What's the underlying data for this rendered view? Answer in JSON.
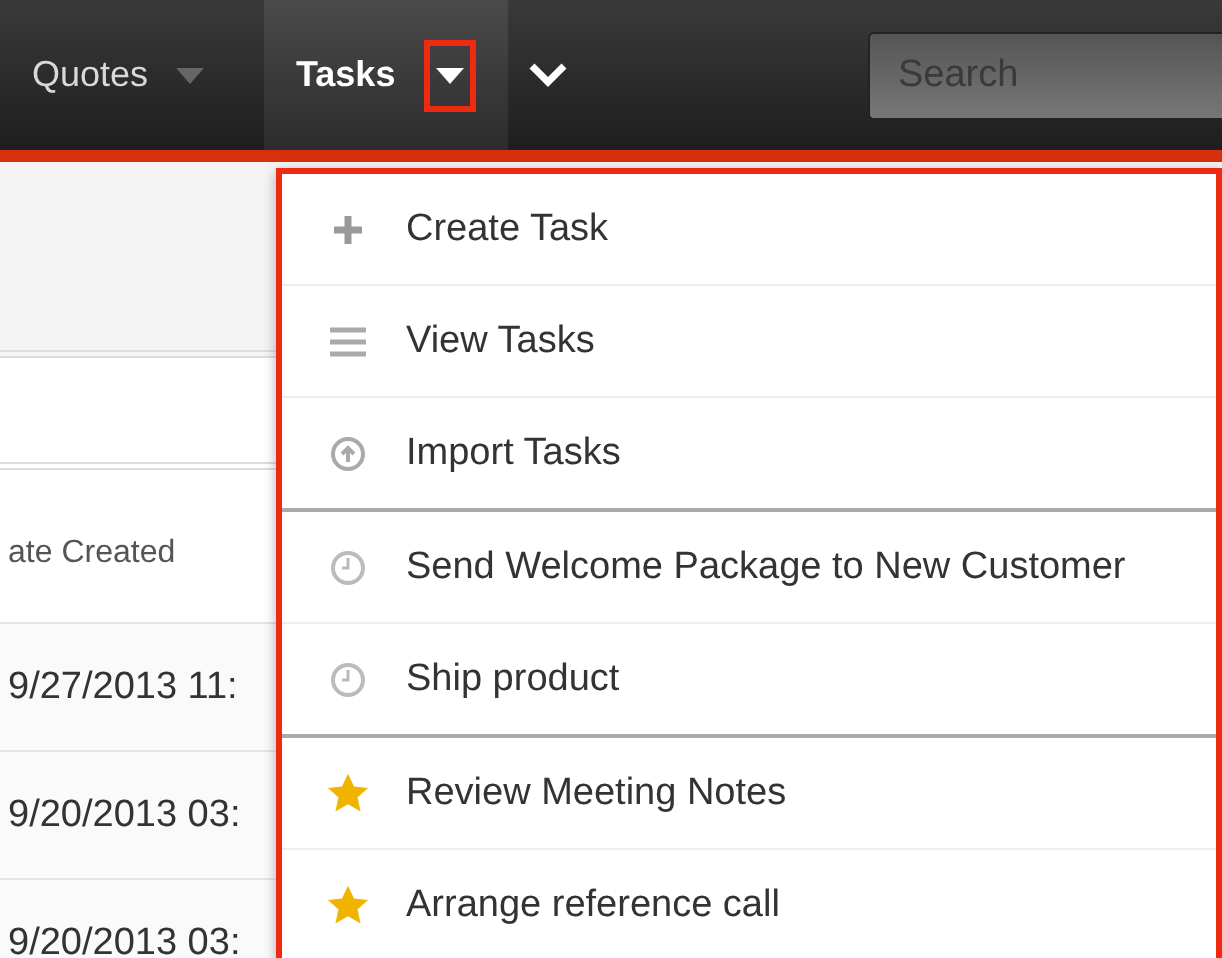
{
  "nav": {
    "tabs": [
      {
        "label": "Quotes",
        "selected": false
      },
      {
        "label": "Tasks",
        "selected": true
      }
    ],
    "search": {
      "placeholder": "Search"
    }
  },
  "table": {
    "header": "ate Created",
    "rows": [
      "9/27/2013 11:",
      "9/20/2013 03:",
      "9/20/2013 03:"
    ]
  },
  "menu": {
    "groups": [
      {
        "items": [
          {
            "kind": "create",
            "label": "Create Task"
          },
          {
            "kind": "list",
            "label": "View Tasks"
          },
          {
            "kind": "import",
            "label": "Import Tasks"
          }
        ]
      },
      {
        "items": [
          {
            "kind": "recent",
            "label": "Send Welcome Package to New Customer"
          },
          {
            "kind": "recent",
            "label": "Ship product"
          }
        ]
      },
      {
        "items": [
          {
            "kind": "favorite",
            "label": "Review Meeting Notes"
          },
          {
            "kind": "favorite",
            "label": "Arrange reference call"
          }
        ]
      }
    ]
  }
}
